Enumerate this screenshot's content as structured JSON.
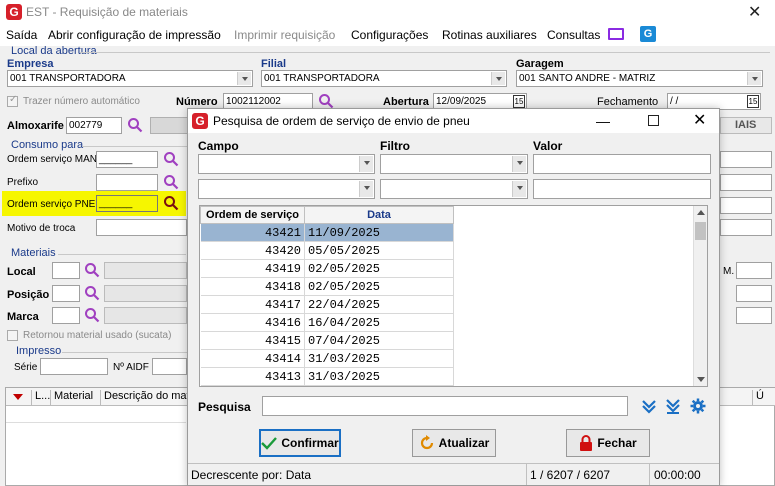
{
  "window": {
    "title": "EST - Requisição de materiais"
  },
  "menu": {
    "saida": "Saída",
    "abrir_config": "Abrir configuração de impressão",
    "imprimir": "Imprimir requisição",
    "configuracoes": "Configurações",
    "rotinas": "Rotinas auxiliares",
    "consultas": "Consultas"
  },
  "local_abertura": {
    "label": "Local da abertura",
    "empresa_label": "Empresa",
    "empresa_value": "001 TRANSPORTADORA",
    "filial_label": "Filial",
    "filial_value": "001 TRANSPORTADORA",
    "garagem_label": "Garagem",
    "garagem_value": "001 SANTO ANDRE - MATRIZ",
    "trazer_numero": "Trazer número automático",
    "numero_label": "Número",
    "numero_value": "1002112002",
    "abertura_label": "Abertura",
    "abertura_value": "12/09/2025",
    "fechamento_label": "Fechamento",
    "fechamento_value": " / /",
    "almoxarife_label": "Almoxarife",
    "almoxarife_value": "002779",
    "right_partial": "IAIS"
  },
  "consumo": {
    "label": "Consumo para",
    "os_man_label": "Ordem serviço MAN",
    "os_man_value": "______",
    "prefixo_label": "Prefixo",
    "os_pne_label": "Ordem serviço PNE",
    "os_pne_value": "______",
    "motivo_label": "Motivo de troca"
  },
  "materiais": {
    "label": "Materiais",
    "local_label": "Local",
    "posicao_label": "Posição",
    "marca_label": "Marca",
    "retornou": "Retornou material usado (sucata)",
    "m_partial": "M."
  },
  "impresso": {
    "label": "Impresso",
    "serie_label": "Série",
    "aidf_label": "Nº AIDF"
  },
  "bottom_grid": {
    "col1": "L...",
    "col2": "Material",
    "col3": "Descrição do mater",
    "col_right": "Ú"
  },
  "dialog": {
    "title": "Pesquisa de ordem de serviço de envio de pneu",
    "campo_label": "Campo",
    "filtro_label": "Filtro",
    "valor_label": "Valor",
    "col_ordem": "Ordem de serviço",
    "col_data": "Data",
    "rows": [
      {
        "ordem": "43421",
        "data": "11/09/2025"
      },
      {
        "ordem": "43420",
        "data": "05/05/2025"
      },
      {
        "ordem": "43419",
        "data": "02/05/2025"
      },
      {
        "ordem": "43418",
        "data": "02/05/2025"
      },
      {
        "ordem": "43417",
        "data": "22/04/2025"
      },
      {
        "ordem": "43416",
        "data": "16/04/2025"
      },
      {
        "ordem": "43415",
        "data": "07/04/2025"
      },
      {
        "ordem": "43414",
        "data": "31/03/2025"
      },
      {
        "ordem": "43413",
        "data": "31/03/2025"
      }
    ],
    "pesquisa_label": "Pesquisa",
    "confirmar": "Confirmar",
    "atualizar": "Atualizar",
    "fechar": "Fechar",
    "status_sort": "Decrescente por:  Data",
    "status_count": "1 / 6207 / 6207",
    "status_time": "00:00:00",
    "accent_selected": "#99b4d1",
    "accent_blue": "#1a6fc4"
  }
}
